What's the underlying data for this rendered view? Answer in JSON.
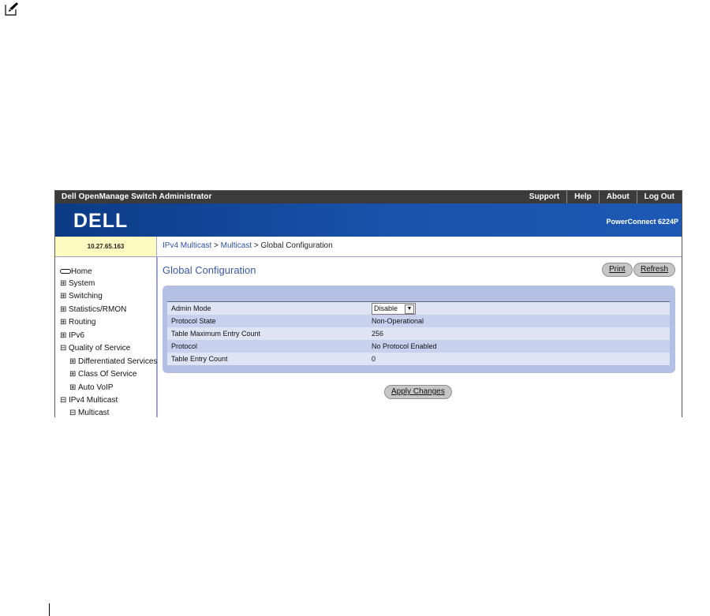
{
  "topbar": {
    "title": "Dell OpenManage Switch Administrator",
    "links": [
      "Support",
      "Help",
      "About",
      "Log Out"
    ]
  },
  "banner": {
    "logo_text": "DELL",
    "model": "PowerConnect 6224P"
  },
  "infobar": {
    "ip": "10.27.65.163",
    "breadcrumb": {
      "crumb1": "IPv4 Multicast",
      "sep1": " > ",
      "crumb2": "Multicast",
      "sep2": " > ",
      "current": "Global Configuration"
    }
  },
  "sidebar": {
    "items": [
      {
        "label": "Home",
        "icon": "home-icon"
      },
      {
        "label": "System",
        "icon": "expand-icon",
        "box": "⊞"
      },
      {
        "label": "Switching",
        "icon": "expand-icon",
        "box": "⊞"
      },
      {
        "label": "Statistics/RMON",
        "icon": "expand-icon",
        "box": "⊞"
      },
      {
        "label": "Routing",
        "icon": "expand-icon",
        "box": "⊞"
      },
      {
        "label": "IPv6",
        "icon": "expand-icon",
        "box": "⊞"
      },
      {
        "label": "Quality of Service",
        "icon": "collapse-icon",
        "box": "⊟"
      },
      {
        "label": "Differentiated Services",
        "icon": "expand-icon",
        "box": "⊞"
      },
      {
        "label": "Class Of Service",
        "icon": "expand-icon",
        "box": "⊞"
      },
      {
        "label": "Auto VoIP",
        "icon": "expand-icon",
        "box": "⊞"
      },
      {
        "label": "IPv4 Multicast",
        "icon": "collapse-icon",
        "box": "⊟"
      },
      {
        "label": "Multicast",
        "icon": "collapse-icon",
        "box": "⊟"
      }
    ]
  },
  "main": {
    "title": "Global Configuration",
    "print_label": "Print",
    "refresh_label": "Refresh",
    "apply_label": "Apply Changes",
    "rows": [
      {
        "label": "Admin Mode",
        "value": "Disable"
      },
      {
        "label": "Protocol State",
        "value": "Non-Operational"
      },
      {
        "label": "Table Maximum Entry Count",
        "value": "256"
      },
      {
        "label": "Protocol",
        "value": "No Protocol Enabled"
      },
      {
        "label": "Table Entry Count",
        "value": "0"
      }
    ]
  },
  "colors": {
    "topbar_bg": "#3b3b3b",
    "banner_blue": "#1a53ad",
    "ip_box_bg": "#fdfbc0",
    "panel_bg": "#b3c0e4",
    "link_blue": "#2d52a8"
  }
}
